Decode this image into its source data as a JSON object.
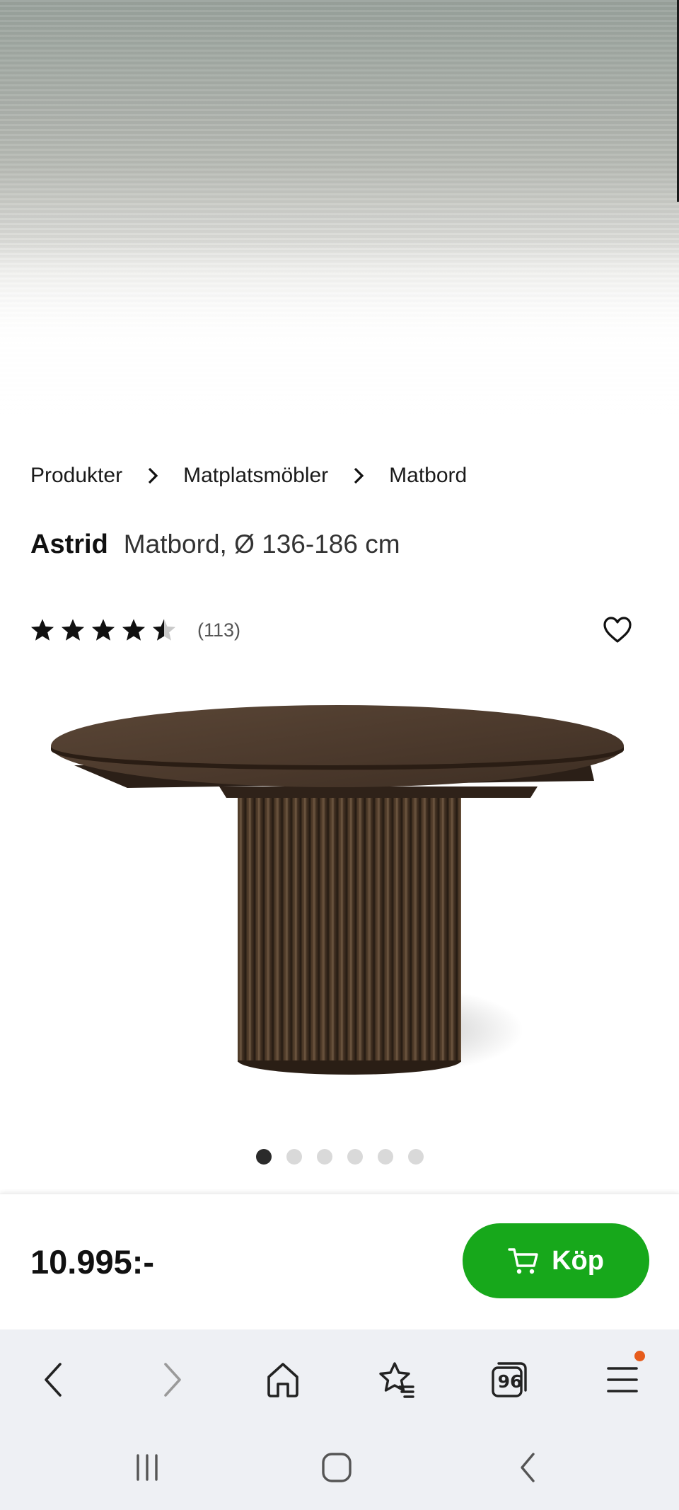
{
  "breadcrumb": {
    "items": [
      "Produkter",
      "Matplatsmöbler",
      "Matbord"
    ]
  },
  "product": {
    "brand": "Astrid",
    "subtitle": "Matbord, Ø 136-186 cm",
    "rating": 4.5,
    "rating_max": 5,
    "review_count": "(113)",
    "image_count": 6,
    "active_image": 1
  },
  "buy_bar": {
    "price": "10.995:-",
    "buy_label": "Köp",
    "accent": "#17a81b"
  },
  "browser": {
    "tab_count": "96",
    "icons": [
      "back-icon",
      "forward-icon",
      "home-icon",
      "bookmark-star-icon",
      "tabs-icon",
      "menu-icon"
    ],
    "menu_notification_color": "#e65c1c"
  },
  "system_nav": {
    "icons": [
      "recent-apps-icon",
      "home-circle-icon",
      "system-back-icon"
    ]
  }
}
